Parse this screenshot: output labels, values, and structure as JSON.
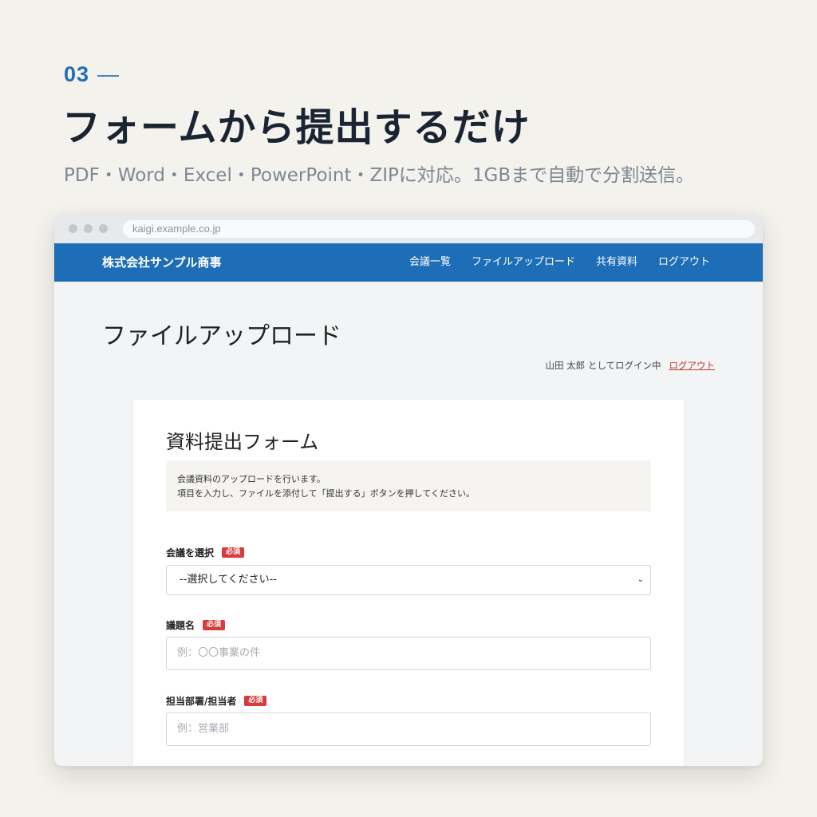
{
  "promo": {
    "step": "03",
    "dash": "—",
    "headline": "フォームから提出するだけ",
    "subline": "PDF・Word・Excel・PowerPoint・ZIPに対応。1GBまで自動で分割送信。"
  },
  "browser": {
    "url": "kaigi.example.co.jp"
  },
  "header": {
    "brand": "株式会社サンプル商事",
    "nav": [
      "会議一覧",
      "ファイルアップロード",
      "共有資料",
      "ログアウト"
    ]
  },
  "page": {
    "title": "ファイルアップロード",
    "login_status": "山田 太郎 としてログイン中",
    "logout_link": "ログアウト"
  },
  "form": {
    "title": "資料提出フォーム",
    "notice_line1": "会議資料のアップロードを行います。",
    "notice_line2": "項目を入力し、ファイルを添付して「提出する」ボタンを押してください。",
    "required_badge": "必須",
    "meeting_label": "会議を選択",
    "meeting_selected": "--選択してください--",
    "subject_label": "議題名",
    "subject_placeholder": "例：〇〇事業の件",
    "dept_label": "担当部署/担当者",
    "dept_placeholder": "例：営業部"
  },
  "colors": {
    "accent": "#1e6eb7",
    "required": "#d63d3d",
    "logout_link": "#c0392b"
  }
}
